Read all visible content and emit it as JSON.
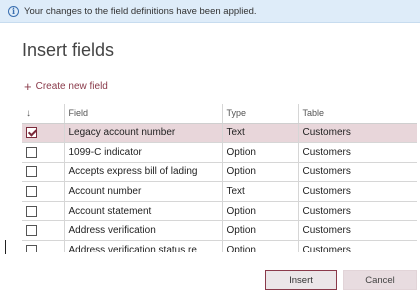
{
  "info_bar": {
    "icon": "info-icon",
    "message": "Your changes to the field definitions have been applied."
  },
  "title": "Insert fields",
  "create_link": {
    "icon": "plus-icon",
    "label": "Create new field"
  },
  "grid": {
    "sort_indicator": "↓",
    "columns": {
      "field": "Field",
      "type": "Type",
      "table": "Table"
    },
    "rows": [
      {
        "checked": true,
        "field": "Legacy account number",
        "type": "Text",
        "table": "Customers"
      },
      {
        "checked": false,
        "field": "1099-C indicator",
        "type": "Option",
        "table": "Customers"
      },
      {
        "checked": false,
        "field": "Accepts express bill of lading",
        "type": "Option",
        "table": "Customers"
      },
      {
        "checked": false,
        "field": "Account number",
        "type": "Text",
        "table": "Customers"
      },
      {
        "checked": false,
        "field": "Account statement",
        "type": "Option",
        "table": "Customers"
      },
      {
        "checked": false,
        "field": "Address verification",
        "type": "Option",
        "table": "Customers"
      },
      {
        "checked": false,
        "field": "Address verification status re",
        "type": "Option",
        "table": "Customers"
      }
    ]
  },
  "buttons": {
    "insert": "Insert",
    "cancel": "Cancel"
  },
  "colors": {
    "accent": "#8a3a4a",
    "selected_row": "#e8d6da",
    "info_bar": "#deecf9"
  }
}
